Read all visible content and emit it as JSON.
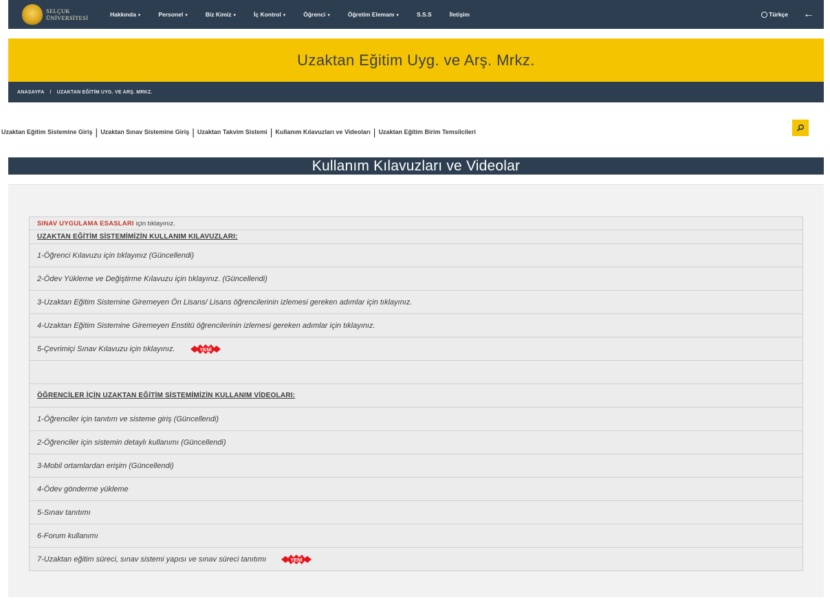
{
  "brand": {
    "line1": "SELÇUK",
    "line2": "ÜNİVERSİTESİ"
  },
  "nav": [
    {
      "label": "Hakkında",
      "caret": "▾"
    },
    {
      "label": "Personel",
      "caret": "▾"
    },
    {
      "label": "Biz Kimiz",
      "caret": "▾"
    },
    {
      "label": "İç Kontrol",
      "caret": "▾"
    },
    {
      "label": "Öğrenci",
      "caret": "▾"
    },
    {
      "label": "Öğretim Elemanı",
      "caret": "▾"
    },
    {
      "label": "S.S.S",
      "caret": ""
    },
    {
      "label": "İletişim",
      "caret": ""
    }
  ],
  "language": "Türkçe",
  "hero_title": "Uzaktan Eğitim Uyg. ve Arş. Mrkz.",
  "breadcrumb": [
    "ANASAYFA",
    "UZAKTAN EĞİTİM UYG. VE ARŞ. MRKZ."
  ],
  "breadcrumb_separator": "/",
  "quick_links": [
    "Uzaktan Eğitim Sistemine Giriş",
    "Uzaktan Sınav Sistemine Giriş",
    "Uzaktan Takvim Sistemi",
    "Kullanım Kılavuzları ve Videoları",
    "Uzaktan Eğitim Birim Temsilcileri"
  ],
  "link_separator": "|",
  "page_title": "Kullanım Kılavuzları ve Videolar",
  "content": {
    "exam_rules_link": "SINAV UYGULAMA ESASLARI",
    "exam_rules_suffix": "için tıklayınız.",
    "guides_header": "UZAKTAN EĞİTİM SİSTEMİMİZİN KULLANIM KILAVUZLARI:",
    "guides": [
      "1-Öğrenci Kılavuzu için tıklayınız   (Güncellendi)",
      "2-Ödev Yükleme ve Değiştirme Kılavuzu için tıklayınız. (Güncellendi)",
      "3-Uzaktan Eğitim Sistemine Giremeyen Ön Lisans/ Lisans öğrencilerinin izlemesi gereken adımlar için tıklayınız.",
      "4-Uzaktan Eğitim Sistemine Giremeyen Enstitü öğrencilerinin izlemesi gereken adımlar için tıklayınız.",
      "5-Çevrimiçi Sınav Kılavuzu için tıklayınız."
    ],
    "videos_header": "ÖĞRENCİLER İÇİN UZAKTAN EĞİTİM SİSTEMİMİZİN KULLANIM VİDEOLARI:",
    "videos": [
      "1-Öğrenciler için tanıtım ve sisteme giriş (Güncellendi)",
      "2-Öğrenciler için sistemin detaylı kullanımı (Güncellendi)",
      "3-Mobil ortamlardan erişim (Güncellendi)",
      "4-Ödev gönderme yükleme",
      "5-Sınav tanıtımı",
      "6-Forum kullanımı",
      "7-Uzaktan eğitim süreci, sınav sistemi yapısı ve sınav süreci tanıtımı"
    ],
    "new_badge_text": "YENİ"
  },
  "colors": {
    "navy": "#2c3e50",
    "yellow": "#f5c400",
    "red": "#c0392b",
    "panel": "#f2f2f2"
  },
  "icons": [
    "logo-emblem",
    "globe-icon",
    "back-arrow-icon",
    "search-icon",
    "new-badge-icon",
    "caret-down-icon"
  ]
}
